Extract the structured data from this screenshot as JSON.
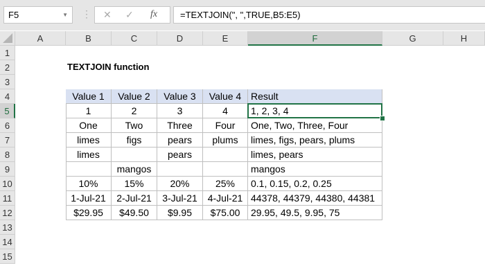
{
  "name_box": "F5",
  "formula": "=TEXTJOIN(\", \",TRUE,B5:E5)",
  "formula_icons": [
    "cancel-icon",
    "enter-icon",
    "fx-icon"
  ],
  "columns": [
    "A",
    "B",
    "C",
    "D",
    "E",
    "F",
    "G",
    "H"
  ],
  "rows": [
    "1",
    "2",
    "3",
    "4",
    "5",
    "6",
    "7",
    "8",
    "9",
    "10",
    "11",
    "12",
    "13",
    "14",
    "15"
  ],
  "selected_cell": "F5",
  "title": "TEXTJOIN function",
  "table": {
    "headers": [
      "Value 1",
      "Value 2",
      "Value 3",
      "Value 4",
      "Result"
    ],
    "rows": [
      [
        "1",
        "2",
        "3",
        "4",
        "1, 2, 3, 4"
      ],
      [
        "One",
        "Two",
        "Three",
        "Four",
        "One, Two, Three, Four"
      ],
      [
        "limes",
        "figs",
        "pears",
        "plums",
        "limes, figs, pears, plums"
      ],
      [
        "limes",
        "",
        "pears",
        "",
        "limes, pears"
      ],
      [
        "",
        "mangos",
        "",
        "",
        "mangos"
      ],
      [
        "10%",
        "15%",
        "20%",
        "25%",
        "0.1, 0.15, 0.2, 0.25"
      ],
      [
        "1-Jul-21",
        "2-Jul-21",
        "3-Jul-21",
        "4-Jul-21",
        "44378, 44379, 44380, 44381"
      ],
      [
        "$29.95",
        "$49.50",
        "$9.95",
        "$75.00",
        "29.95, 49.5, 9.95, 75"
      ]
    ]
  },
  "colors": {
    "accent": "#217346",
    "header_fill": "#d9e1f2"
  }
}
